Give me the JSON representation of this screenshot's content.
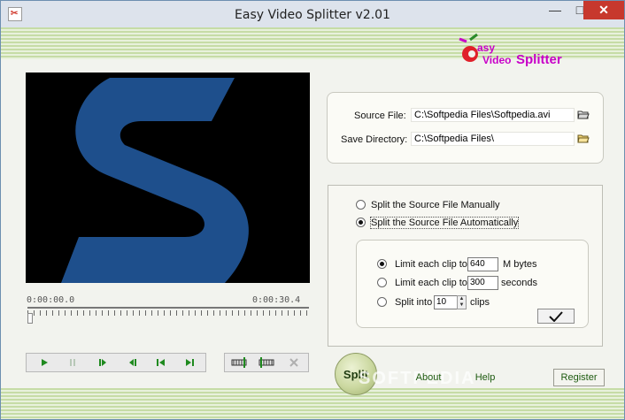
{
  "window": {
    "title": "Easy Video Splitter v2.01",
    "minimize": "—",
    "maximize": "□",
    "close": "✕"
  },
  "logo": {
    "text": "Easy Video Splitter"
  },
  "player": {
    "time_start": "0:00:00.0",
    "time_end": "0:00:30.4",
    "position_fraction": 0.0,
    "video_logo_color": "#1e4f8c"
  },
  "source": {
    "source_label": "Source File:",
    "source_value": "C:\\Softpedia Files\\Softpedia.avi",
    "save_label": "Save Directory:",
    "save_value": "C:\\Softpedia Files\\"
  },
  "mode": {
    "manual_label": "Split the Source File Manually",
    "auto_label": "Split the Source File Automatically",
    "selected": "auto"
  },
  "auto": {
    "size_label": "Limit each clip to",
    "size_value": "640",
    "size_unit": "M bytes",
    "time_label": "Limit each clip to",
    "time_value": "300",
    "time_unit": "seconds",
    "count_label": "Split into",
    "count_value": "10",
    "count_unit": "clips",
    "selected": "size"
  },
  "buttons": {
    "split": "Split",
    "about": "About",
    "help": "Help",
    "register": "Register"
  },
  "watermark": "SOFTPEDIA",
  "colors": {
    "accent_green": "#1d5a0f",
    "banner_green": "#c6dca6",
    "logo_red": "#e0202a",
    "logo_magenta": "#c800c8"
  }
}
